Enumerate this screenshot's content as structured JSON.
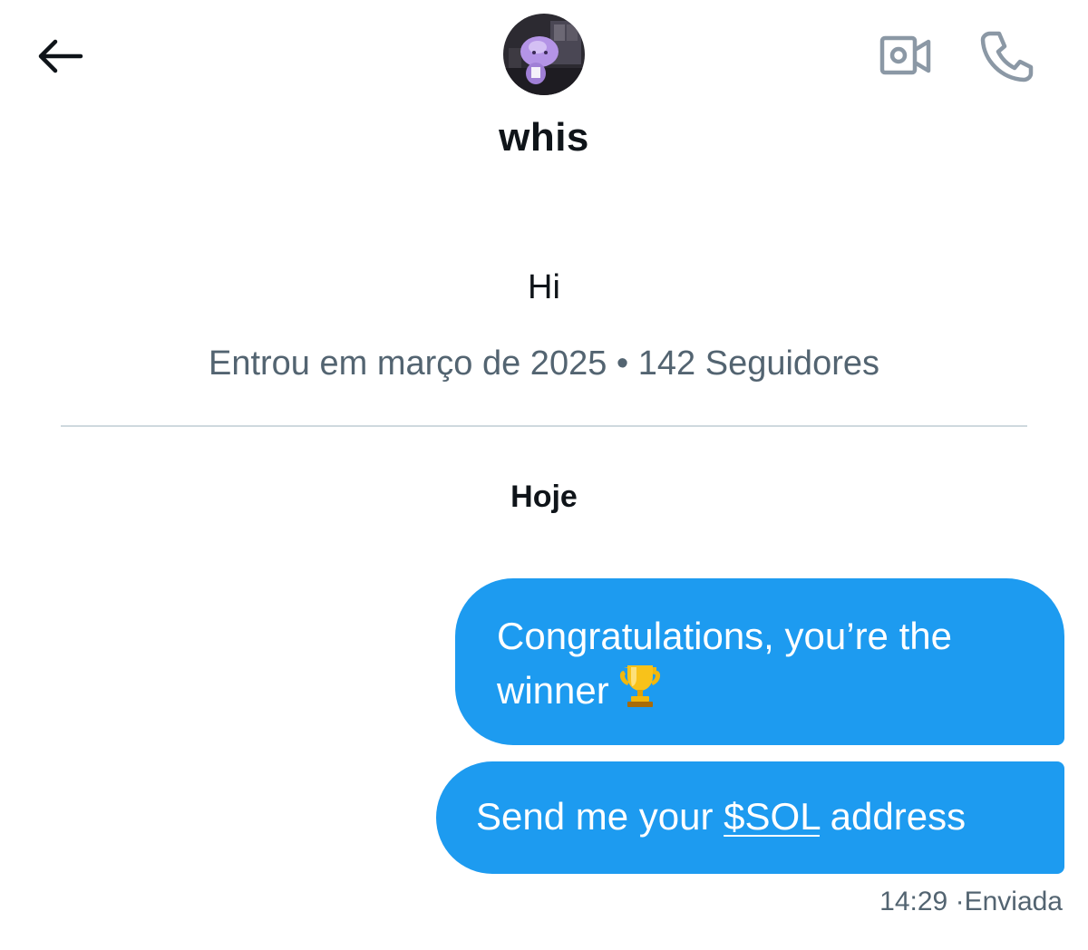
{
  "header": {
    "back_icon": "arrow-left-icon",
    "avatar_icon": "profile-avatar",
    "video_icon": "video-call-icon",
    "phone_icon": "phone-call-icon"
  },
  "profile": {
    "username": "whis",
    "bio": "Hi",
    "joined": "Entrou em março de 2025",
    "separator": "•",
    "followers": "142 Seguidores"
  },
  "conversation": {
    "date_label": "Hoje",
    "messages": [
      {
        "text": "Congratulations, you’re the winner",
        "emoji_icon": "trophy-icon"
      },
      {
        "text_before": "Send me your ",
        "link": "$SOL",
        "text_after": " address"
      }
    ],
    "status": {
      "time": "14:29",
      "separator": "·",
      "state": "Enviada"
    }
  },
  "colors": {
    "bubble": "#1d9bf0",
    "secondary_text": "#536471",
    "divider": "#cfd9de",
    "icon_gray": "#8b98a5"
  }
}
